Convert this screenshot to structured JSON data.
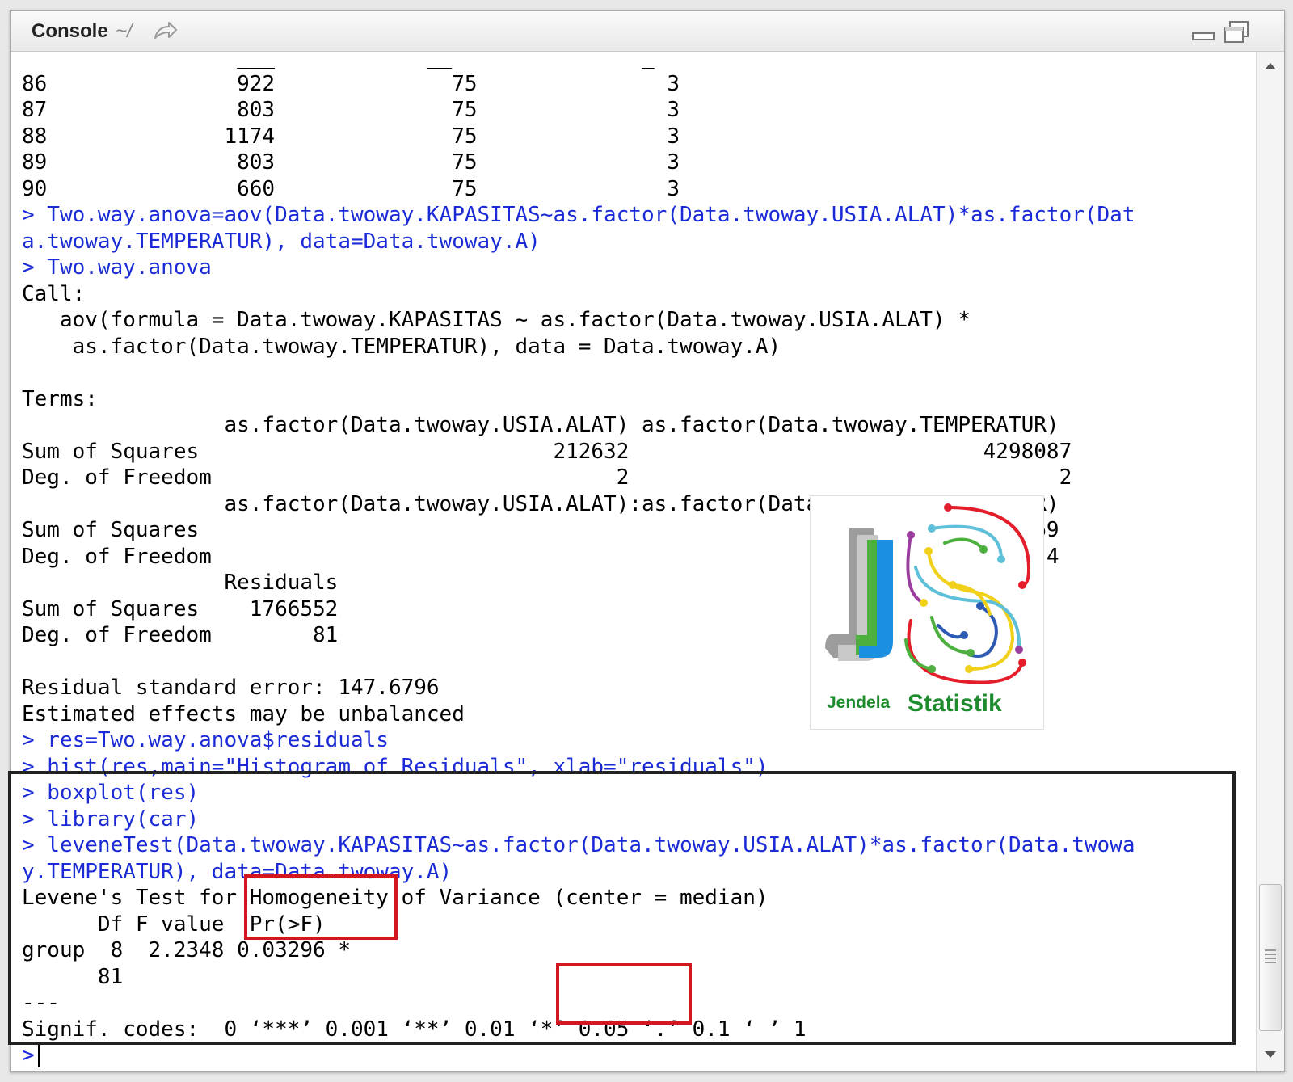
{
  "header": {
    "title": "Console",
    "path": "~/"
  },
  "console_lines": [
    {
      "text": "86               922              75               3",
      "type": "out"
    },
    {
      "text": "87               803              75               3",
      "type": "out"
    },
    {
      "text": "88              1174              75               3",
      "type": "out"
    },
    {
      "text": "89               803              75               3",
      "type": "out"
    },
    {
      "text": "90               660              75               3",
      "type": "out"
    },
    {
      "text": "> Two.way.anova=aov(Data.twoway.KAPASITAS~as.factor(Data.twoway.USIA.ALAT)*as.factor(Dat",
      "type": "cmd"
    },
    {
      "text": "a.twoway.TEMPERATUR), data=Data.twoway.A)",
      "type": "cmd"
    },
    {
      "text": "> Two.way.anova",
      "type": "cmd"
    },
    {
      "text": "Call:",
      "type": "out"
    },
    {
      "text": "   aov(formula = Data.twoway.KAPASITAS ~ as.factor(Data.twoway.USIA.ALAT) *",
      "type": "out"
    },
    {
      "text": "    as.factor(Data.twoway.TEMPERATUR), data = Data.twoway.A)",
      "type": "out"
    },
    {
      "text": "",
      "type": "out"
    },
    {
      "text": "Terms:",
      "type": "out"
    },
    {
      "text": "                as.factor(Data.twoway.USIA.ALAT) as.factor(Data.twoway.TEMPERATUR)",
      "type": "out"
    },
    {
      "text": "Sum of Squares                            212632                            4298087",
      "type": "out"
    },
    {
      "text": "Deg. of Freedom                                2                                  2",
      "type": "out"
    },
    {
      "text": "                as.factor(Data.twoway.USIA.ALAT):as.factor(Data.twoway.TEMPERATUR)",
      "type": "out"
    },
    {
      "text": "Sum of Squares                                                              834969",
      "type": "out"
    },
    {
      "text": "Deg. of Freedom                                                                  4",
      "type": "out"
    },
    {
      "text": "                Residuals",
      "type": "out"
    },
    {
      "text": "Sum of Squares    1766552",
      "type": "out"
    },
    {
      "text": "Deg. of Freedom        81",
      "type": "out"
    },
    {
      "text": "",
      "type": "out"
    },
    {
      "text": "Residual standard error: 147.6796",
      "type": "out"
    },
    {
      "text": "Estimated effects may be unbalanced",
      "type": "out"
    },
    {
      "text": "> res=Two.way.anova$residuals",
      "type": "cmd"
    },
    {
      "text": "> hist(res,main=\"Histogram of Residuals\", xlab=\"residuals\")",
      "type": "cmd"
    },
    {
      "text": "> boxplot(res)",
      "type": "cmd"
    },
    {
      "text": "> library(car)",
      "type": "cmd"
    },
    {
      "text": "> leveneTest(Data.twoway.KAPASITAS~as.factor(Data.twoway.USIA.ALAT)*as.factor(Data.twowa",
      "type": "cmd"
    },
    {
      "text": "y.TEMPERATUR), data=Data.twoway.A)",
      "type": "cmd"
    },
    {
      "text": "Levene's Test for Homogeneity of Variance (center = median)",
      "type": "out"
    },
    {
      "text": "      Df F value  Pr(>F)",
      "type": "out"
    },
    {
      "text": "group  8  2.2348 0.03296 *",
      "type": "out"
    },
    {
      "text": "      81",
      "type": "out"
    },
    {
      "text": "---",
      "type": "out"
    },
    {
      "text": "Signif. codes:  0 ‘***’ 0.001 ‘**’ 0.01 ‘*’ 0.05 ‘.’ 0.1 ‘ ’ 1",
      "type": "out"
    }
  ],
  "input_prompt": ">",
  "logo": {
    "brand_left": "Jendela",
    "brand_right": "Statistik"
  },
  "colors": {
    "command": "#1a2bd6",
    "highlight_box": "#d4161f",
    "frame": "#222222",
    "logo_green": "#1e8c2e"
  },
  "icons": {
    "goto_directory": "arrow-forward-icon",
    "minimize": "minimize-icon",
    "maximize": "maximize-icon",
    "scroll_up": "triangle-up-icon",
    "scroll_down": "triangle-down-icon"
  }
}
